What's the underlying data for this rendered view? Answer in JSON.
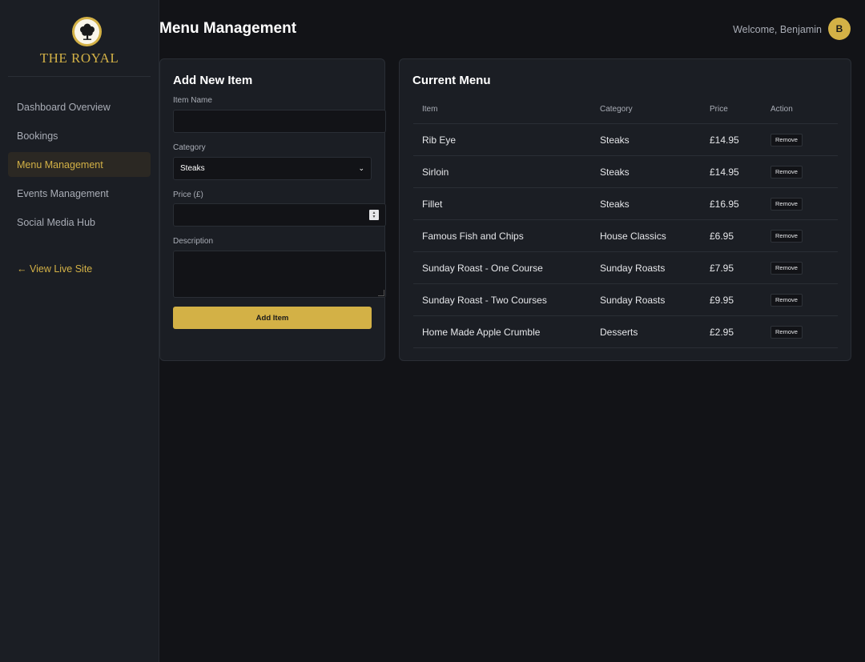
{
  "brand": {
    "name": "THE ROYAL",
    "logo_icon": "oak-tree-icon"
  },
  "sidebar": {
    "items": [
      {
        "label": "Dashboard Overview",
        "active": false
      },
      {
        "label": "Bookings",
        "active": false
      },
      {
        "label": "Menu Management",
        "active": true
      },
      {
        "label": "Events Management",
        "active": false
      },
      {
        "label": "Social Media Hub",
        "active": false
      }
    ],
    "live_link": "← View Live Site"
  },
  "header": {
    "title": "Menu Management",
    "welcome": "Welcome, Benjamin",
    "avatar_initial": "B"
  },
  "add_form": {
    "title": "Add New Item",
    "item_name_label": "Item Name",
    "item_name_value": "",
    "category_label": "Category",
    "category_value": "Steaks",
    "price_label": "Price (£)",
    "price_value": "",
    "description_label": "Description",
    "description_value": "",
    "submit_label": "Add Item"
  },
  "menu": {
    "title": "Current Menu",
    "columns": [
      "Item",
      "Category",
      "Price",
      "Action"
    ],
    "rows": [
      {
        "item": "Rib Eye",
        "category": "Steaks",
        "price": "£14.95",
        "action": "Remove"
      },
      {
        "item": "Sirloin",
        "category": "Steaks",
        "price": "£14.95",
        "action": "Remove"
      },
      {
        "item": "Fillet",
        "category": "Steaks",
        "price": "£16.95",
        "action": "Remove"
      },
      {
        "item": "Famous Fish and Chips",
        "category": "House Classics",
        "price": "£6.95",
        "action": "Remove"
      },
      {
        "item": "Sunday Roast - One Course",
        "category": "Sunday Roasts",
        "price": "£7.95",
        "action": "Remove"
      },
      {
        "item": "Sunday Roast - Two Courses",
        "category": "Sunday Roasts",
        "price": "£9.95",
        "action": "Remove"
      },
      {
        "item": "Home Made Apple Crumble",
        "category": "Desserts",
        "price": "£2.95",
        "action": "Remove"
      }
    ]
  },
  "colors": {
    "accent": "#d3b146",
    "background": "#121317",
    "panel": "#1b1e24"
  }
}
